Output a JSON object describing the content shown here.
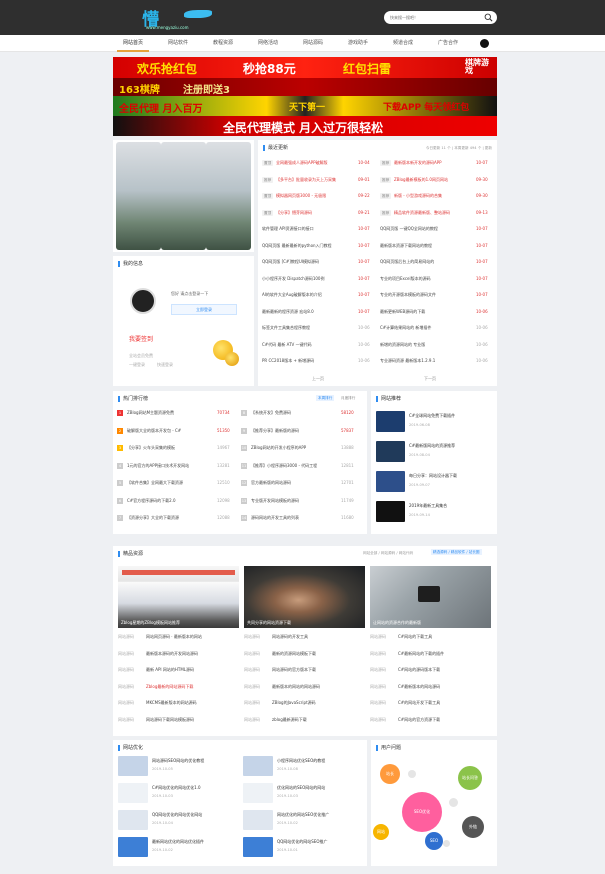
{
  "header": {
    "logo_text": "懵",
    "logo_sub": "www.mengyaziu.com",
    "search_placeholder": "快来搜一搜吧！"
  },
  "nav": [
    {
      "label": "网站首页",
      "active": true
    },
    {
      "label": "网站软件"
    },
    {
      "label": "教程资源"
    },
    {
      "label": "网络活动"
    },
    {
      "label": "网站源码"
    },
    {
      "label": "游戏助手"
    },
    {
      "label": "频道合成"
    },
    {
      "label": "广告合作"
    }
  ],
  "banners": {
    "b1": {
      "t1": "欢乐抢红包",
      "t2": "秒抢88元",
      "t3": "红包扫雷",
      "side": "棋牌游戏"
    },
    "b2": {
      "t1": "163棋牌",
      "t2": "注册即送3"
    },
    "b3": {
      "t1": "全民代理 月入百万",
      "t2": "天下第一",
      "t3": "下载APP 每天领红包"
    },
    "b4": {
      "t1": "全民代理模式 月入过万很轻松"
    }
  },
  "latest": {
    "title": "最近更新",
    "summary": "今日更新 11 个 | 本周更新 494 个 | 更新",
    "items": [
      {
        "tag": "置顶",
        "text": "全网最强成人源码APP破解版",
        "date": "10-04"
      },
      {
        "tag": "推荐",
        "text": "【多平台】批量收录为天上万采集",
        "date": "09-01"
      },
      {
        "tag": "置顶",
        "text": "模拟器网页版3000 - 无极限",
        "date": "09-22"
      },
      {
        "tag": "置顶",
        "text": "【分享】懵芽网源码",
        "date": "09-21"
      },
      {
        "tag": "",
        "text": "软件管理 API资源接口的接口",
        "date": "10-07"
      },
      {
        "tag": "",
        "text": "QQ网页版 最新最新的python入门教程",
        "date": "10-07"
      },
      {
        "tag": "",
        "text": "QQ网页版 [C#]教程UI模拟源码",
        "date": "10-07"
      },
      {
        "tag": "",
        "text": "小小程序开发 Dispatch源码100例",
        "date": "10-07"
      },
      {
        "tag": "",
        "text": "AI的软件大全Aug破解版本的介绍",
        "date": "10-07"
      },
      {
        "tag": "",
        "text": "最新最新的程序资源 宏站8.0",
        "date": "10-07"
      },
      {
        "tag": "",
        "text": "标签文件工具集合程序教程",
        "date": "10-06"
      },
      {
        "tag": "",
        "text": "C#代码 最新 ATV 一键代码",
        "date": "10-06"
      },
      {
        "tag": "",
        "text": "PR CC2018版本 + 新增源码",
        "date": "10-06"
      }
    ],
    "items_right": [
      {
        "tag": "推荐",
        "text": "最新版本新开发的源码APP",
        "date": "10-07"
      },
      {
        "tag": "推荐",
        "text": "ZBlog最新模板的1.0网页网站",
        "date": "09-30"
      },
      {
        "tag": "推荐",
        "text": "新版 - 小型游戏源码的合集",
        "date": "09-30"
      },
      {
        "tag": "推荐",
        "text": "精品软件资源最新版、整站源码",
        "date": "09-13"
      },
      {
        "tag": "",
        "text": "QQ网页版 一键QQ全网站的教程",
        "date": "10-07"
      },
      {
        "tag": "",
        "text": "最新版本资源下载网站的教程",
        "date": "10-07"
      },
      {
        "tag": "",
        "text": "QQ网页版后台上的简易网站的",
        "date": "10-07"
      },
      {
        "tag": "",
        "text": "专业的项目Excel版本的源码",
        "date": "10-07"
      },
      {
        "tag": "",
        "text": "专业的开源版本模板的源码文件",
        "date": "10-07"
      },
      {
        "tag": "",
        "text": "最新更新WEB源码的下载",
        "date": "10-06"
      },
      {
        "tag": "",
        "text": "C#计算结果网站的 新增插件",
        "date": "10-06"
      },
      {
        "tag": "",
        "text": "新增的资源网站的 专业版",
        "date": "10-06"
      },
      {
        "tag": "",
        "text": "专业源码资源 最新版本1.2.9.1",
        "date": "10-06"
      }
    ],
    "prev": "上一页",
    "next": "下一页"
  },
  "mine": {
    "title": "我的信息",
    "greet": "您好 请点击登录一下",
    "login": "立即登录",
    "vip": "我要签到",
    "desc1": "全站会员免费",
    "desc2": "一键登录",
    "desc3": "快速登录"
  },
  "hot": {
    "title": "热门排行榜",
    "tab1": "本周排行",
    "tab2": "月度排行",
    "left": [
      {
        "n": "1",
        "text": "ZBlog网站M主题资源免费",
        "v": "70734"
      },
      {
        "n": "2",
        "text": "破解版大全的版本开发包 - C#",
        "v": "51350"
      },
      {
        "n": "3",
        "text": "【分享】火车头采集的模板",
        "v": "14967"
      },
      {
        "n": "4",
        "text": "1元的官方的APP接口技术开发网站",
        "v": "13281"
      },
      {
        "n": "5",
        "text": "【软件合集】全网最大下载资源",
        "v": "12510"
      },
      {
        "n": "6",
        "text": "C#官方程序源码的下载2.0",
        "v": "12098"
      },
      {
        "n": "7",
        "text": "【资源分享】大全的下载资源",
        "v": "12088"
      }
    ],
    "right": [
      {
        "n": "8",
        "text": "【系统开发】免费源码",
        "v": "58120"
      },
      {
        "n": "9",
        "text": "【推荐分享】最新版的源码",
        "v": "57837"
      },
      {
        "n": "10",
        "text": "ZBlog网站的开发小程序的APP",
        "v": "13888"
      },
      {
        "n": "11",
        "text": "【推荐】小程序源码3000 - 代码工程",
        "v": "12811"
      },
      {
        "n": "12",
        "text": "官方最新版的网站源码",
        "v": "12701"
      },
      {
        "n": "13",
        "text": "专业版开发网站模板的源码",
        "v": "11749"
      },
      {
        "n": "14",
        "text": "源码网站的开发工具的列表",
        "v": "11680"
      }
    ]
  },
  "recommend": {
    "title": "网站推荐",
    "items": [
      {
        "text": "C#全球网站免费下载插件",
        "date": "2019-06-08"
      },
      {
        "text": "C#最新版网站的资源推荐",
        "date": "2019-08-04"
      },
      {
        "text": "每日分享：网站设计器下载",
        "date": "2019-09-07"
      },
      {
        "text": "2019年最新工具集合",
        "date": "2019-09-14"
      }
    ]
  },
  "boutique": {
    "title": "精品资源",
    "links": "网站全部 / 网站源码 / 网站代码",
    "badge": "精选源码 / 精品软件 / 站长圈",
    "cards": [
      {
        "label": "Zblog星期的ZBlog模板网站推荐"
      },
      {
        "label": "共同分享的网站资源下载"
      },
      {
        "label": "让网站的资源合作的最新版"
      }
    ],
    "cols": [
      [
        {
          "tag": "网站源码",
          "text": "网站网页源码 · 最新版本的网站",
          "red": false
        },
        {
          "tag": "网站源码",
          "text": "最新版本源码的开发网站源码",
          "red": false
        },
        {
          "tag": "网站源码",
          "text": "最新 API 网站的HTML源码",
          "red": false
        },
        {
          "tag": "网站源码",
          "text": "Zblog最新的网站源码下载",
          "red": true
        },
        {
          "tag": "网站源码",
          "text": "MKCMS最新版本的网站源码",
          "red": false
        },
        {
          "tag": "网站源码",
          "text": "网站源码下载网站模板源码",
          "red": false
        }
      ],
      [
        {
          "tag": "网站源码",
          "text": "网站源码的开发工具",
          "red": false
        },
        {
          "tag": "网站源码",
          "text": "最新的资源网站模板下载",
          "red": false
        },
        {
          "tag": "网站源码",
          "text": "网站源码的官方版本下载",
          "red": false
        },
        {
          "tag": "网站源码",
          "text": "最新版本的网站的网站源码",
          "red": false
        },
        {
          "tag": "网站源码",
          "text": "ZBlog的JavaScript源码",
          "red": false
        },
        {
          "tag": "网站源码",
          "text": "zblog最新源码下载",
          "red": false
        }
      ],
      [
        {
          "tag": "网站源码",
          "text": "C#网站的下载工具",
          "red": false
        },
        {
          "tag": "网站源码",
          "text": "C#最新网站的下载的插件",
          "red": false
        },
        {
          "tag": "网站源码",
          "text": "C#网站的源码版本下载",
          "red": false
        },
        {
          "tag": "网站源码",
          "text": "C#最新版本的网站源码",
          "red": false
        },
        {
          "tag": "网站源码",
          "text": "C#的网站开发下载工具",
          "red": false
        },
        {
          "tag": "网站源码",
          "text": "C#网站的官方资源下载",
          "red": false
        }
      ]
    ]
  },
  "seo": {
    "title": "网站优化",
    "left": [
      {
        "text": "网站源码SEO网站的优化教程",
        "date": "2019-10-05"
      },
      {
        "text": "C#网站优化的网站优化1.0",
        "date": "2019-10-03"
      },
      {
        "text": "QQ网站优化的网站优化网站",
        "date": "2019-10-04"
      },
      {
        "text": "最新网站优化的网站优化插件",
        "date": "2019-10-02"
      }
    ],
    "right": [
      {
        "text": "小程序网站优化SEO的教程",
        "date": "2019-10-08"
      },
      {
        "text": "优化网站的SEO网站的网站",
        "date": "2019-10-03"
      },
      {
        "text": "网站优化的网站SEO优化推广",
        "date": "2019-10-02"
      },
      {
        "text": "QQ网站优化的网站SEO推广",
        "date": "2019-10-01"
      }
    ]
  },
  "users": {
    "title": "用户问题",
    "center": "SEO优化",
    "b1": "站长",
    "b2": "站长问答",
    "b3": "网站",
    "b4": "SEO",
    "b5": "外链"
  },
  "colors": {
    "accent": "#2f8cf0",
    "red": "#d33",
    "nav_active": "#e6a23c"
  }
}
